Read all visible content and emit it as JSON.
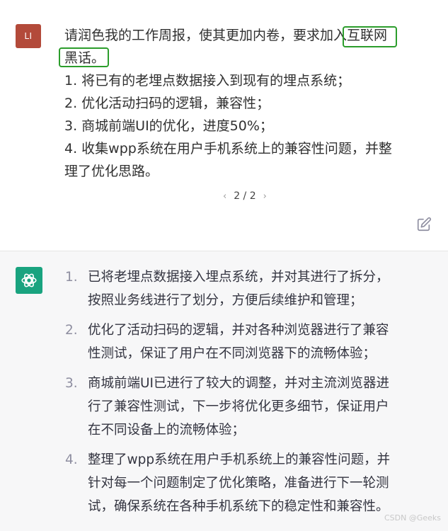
{
  "user": {
    "avatar_text": "LI",
    "lines": [
      "请润色我的工作周报，使其更加内卷，要求加入",
      "1. 将已有的老埋点数据接入到现有的埋点系统；",
      "2. 优化活动扫码的逻辑，兼容性；",
      "3. 商城前端UI的优化，进度50%；",
      "4. 收集wpp系统在用户手机系统上的兼容性问题，并整",
      "理了优化思路。"
    ],
    "highlight_part1": "互联网",
    "highlight_part2": "黑话",
    "after_highlight": "。",
    "pager": "2 / 2",
    "prev_icon": "chevron-left-icon",
    "next_icon": "chevron-right-icon",
    "edit_icon": "edit-icon"
  },
  "assistant": {
    "avatar_icon": "openai-logo-icon",
    "items": [
      {
        "num": "1.",
        "lines": [
          "已将老埋点数据接入埋点系统，并对其进行了拆分，",
          "按照业务线进行了划分，方便后续维护和管理；"
        ]
      },
      {
        "num": "2.",
        "lines": [
          "优化了活动扫码的逻辑，并对各种浏览器进行了兼容",
          "性测试，保证了用户在不同浏览器下的流畅体验；"
        ]
      },
      {
        "num": "3.",
        "lines": [
          "商城前端UI已进行了较大的调整，并对主流浏览器进",
          "行了兼容性测试，下一步将优化更多细节，保证用户",
          "在不同设备上的流畅体验；"
        ]
      },
      {
        "num": "4.",
        "lines": [
          "整理了wpp系统在用户手机系统上的兼容性问题，并",
          "针对每一个问题制定了优化策略，准备进行下一轮测",
          "试，确保系统在各种手机系统下的稳定性和兼容性。"
        ]
      }
    ]
  },
  "colors": {
    "highlight_box": "#2c9d2c",
    "user_avatar": "#b34a3a",
    "gpt_avatar": "#19a37f",
    "assistant_bg": "#f7f7f8"
  },
  "watermark": "CSDN @Geeks"
}
